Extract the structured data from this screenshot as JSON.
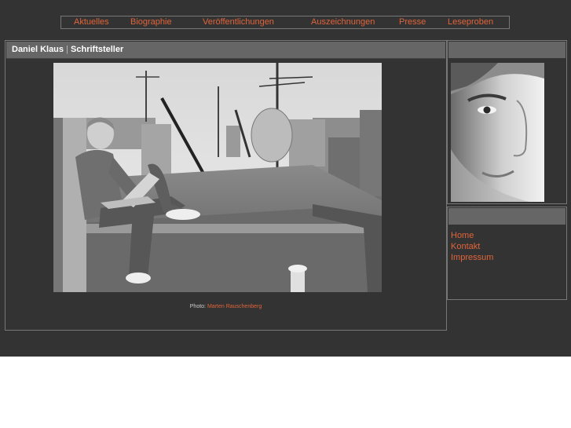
{
  "nav": {
    "items": [
      "Aktuelles",
      "Biographie",
      "Veröffentlichungen",
      "Auszeichnungen",
      "Presse",
      "Leseproben"
    ]
  },
  "main": {
    "author": "Daniel Klaus",
    "separator": "|",
    "role": "Schriftsteller",
    "photo_credit_label": "Photo:",
    "photo_credit_name": "Marten Rauschenberg"
  },
  "side": {
    "links": [
      "Home",
      "Kontakt",
      "Impressum"
    ]
  },
  "colors": {
    "background": "#333333",
    "header": "#666666",
    "link": "#e0643a",
    "text": "#ffffff"
  }
}
